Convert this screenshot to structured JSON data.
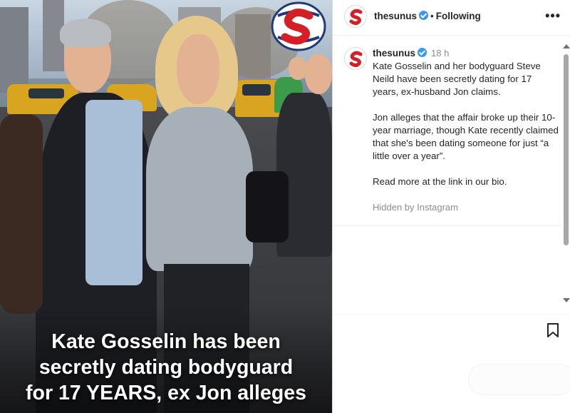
{
  "photo": {
    "caption_lines": [
      "Kate Gosselin has been",
      "secretly dating bodyguard",
      "for 17 YEARS, ex Jon alleges"
    ],
    "logo_icon": "thesun-s-logo"
  },
  "header": {
    "username": "thesunus",
    "separator": "•",
    "follow_status": "Following",
    "more_icon": "more-options-icon",
    "more_glyph": "•••"
  },
  "post": {
    "username": "thesunus",
    "time": "18 h",
    "paragraphs": [
      "Kate Gosselin and her bodyguard Steve Neild have been secretly dating for 17 years, ex-husband Jon claims.",
      "Jon alleges that the affair broke up their 10-year marriage, though Kate recently claimed that she's been dating someone for just “a little over a year”.",
      "Read more at the link in our bio."
    ],
    "hidden_note": "Hidden by Instagram"
  },
  "actions": {
    "save_icon": "bookmark-icon"
  },
  "colors": {
    "verified_blue": "#3897f0",
    "muted_text": "#8e8e8e",
    "caption_text": "#ffffff"
  }
}
